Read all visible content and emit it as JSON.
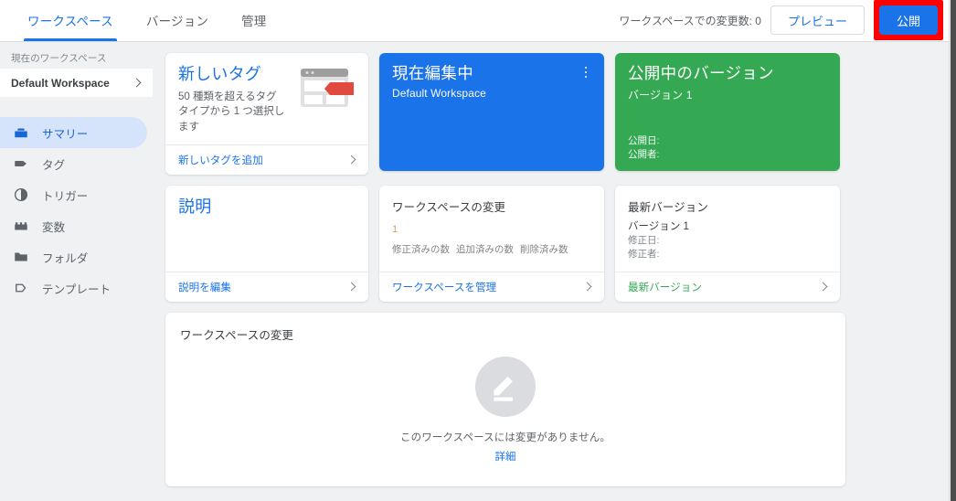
{
  "topbar": {
    "tabs": [
      {
        "label": "ワークスペース",
        "active": true
      },
      {
        "label": "バージョン",
        "active": false
      },
      {
        "label": "管理",
        "active": false
      }
    ],
    "change_count_text": "ワークスペースでの変更数: 0",
    "preview_label": "プレビュー",
    "publish_label": "公開",
    "highlight_color": "#ff0000",
    "accent_color": "#1a73e8"
  },
  "sidebar": {
    "workspace_label": "現在のワークスペース",
    "workspace_name": "Default Workspace",
    "items": [
      {
        "label": "サマリー",
        "icon": "toolbox-icon",
        "active": true
      },
      {
        "label": "タグ",
        "icon": "tag-icon",
        "active": false
      },
      {
        "label": "トリガー",
        "icon": "trigger-icon",
        "active": false
      },
      {
        "label": "変数",
        "icon": "variables-icon",
        "active": false
      },
      {
        "label": "フォルダ",
        "icon": "folder-icon",
        "active": false
      },
      {
        "label": "テンプレート",
        "icon": "template-icon",
        "active": false
      }
    ]
  },
  "cards": {
    "new_tag": {
      "title": "新しいタグ",
      "description": "50 種類を超えるタグタイプから 1 つ選択します",
      "link": "新しいタグを追加",
      "illustration": "browser-tag-illustration"
    },
    "current_workspace": {
      "title": "現在編集中",
      "subtitle": "Default Workspace",
      "menu_icon": "kebab-menu-icon",
      "color": "#1a73e8"
    },
    "published_version": {
      "title": "公開中のバージョン",
      "subtitle": "バージョン 1",
      "published_date_label": "公開日:",
      "publisher_label": "公開者:",
      "color": "#34a853"
    },
    "description": {
      "title": "説明",
      "link": "説明を編集"
    },
    "workspace_changes": {
      "title": "ワークスペースの変更",
      "digit": "1",
      "legend": [
        "修正済みの数",
        "追加済みの数",
        "削除済み数"
      ],
      "link": "ワークスペースを管理"
    },
    "latest_version": {
      "title": "最新バージョン",
      "subtitle": "バージョン 1",
      "modified_date_label": "修正日:",
      "modifier_label": "修正者:",
      "link": "最新バージョン",
      "link_color": "#34a853"
    }
  },
  "bottom_panel": {
    "title": "ワークスペースの変更",
    "empty_icon": "pencil-icon",
    "empty_text": "このワークスペースには変更がありません。",
    "empty_link": "詳細"
  }
}
